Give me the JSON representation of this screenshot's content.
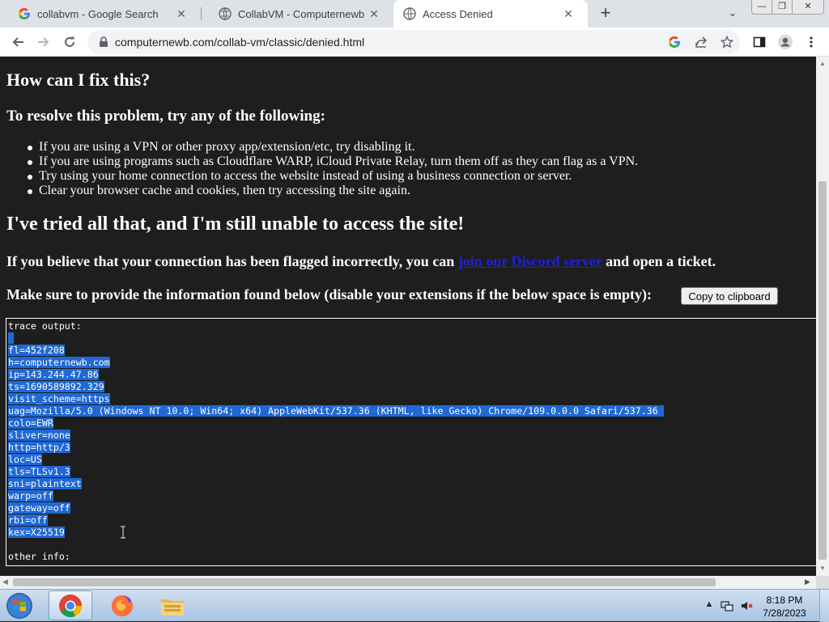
{
  "browser": {
    "tabs": [
      {
        "title": "collabvm - Google Search",
        "icon": "google-g-icon",
        "active": false
      },
      {
        "title": "CollabVM - Computernewb Wiki",
        "icon": "wiki-icon",
        "active": false
      },
      {
        "title": "Access Denied",
        "icon": "globe-icon",
        "active": true
      }
    ],
    "url": "computernewb.com/collab-vm/classic/denied.html"
  },
  "page": {
    "heading_fix": "How can I fix this?",
    "resolve_intro": "To resolve this problem, try any of the following:",
    "tips": [
      "If you are using a VPN or other proxy app/extension/etc, try disabling it.",
      "If you are using programs such as Cloudflare WARP, iCloud Private Relay, turn them off as they can flag as a VPN.",
      "Try using your home connection to access the website instead of using a business connection or server.",
      "Clear your browser cache and cookies, then try accessing the site again."
    ],
    "heading_tried": "I've tried all that, and I'm still unable to access the site!",
    "flag_text_before": "If you believe that your connection has been flagged incorrectly, you can ",
    "flag_link": "join our Discord server",
    "flag_text_after": " and open a ticket.",
    "info_text": "Make sure to provide the information found below (disable your extensions if the below space is empty):",
    "copy_button": "Copy to clipboard",
    "trace": {
      "header": "trace output:",
      "lines": [
        " ",
        "fl=452f208",
        "h=computernewb.com",
        "ip=143.244.47.86",
        "ts=1690589892.329",
        "visit_scheme=https",
        "uag=Mozilla/5.0 (Windows NT 10.0; Win64; x64) AppleWebKit/537.36 (KHTML, like Gecko) Chrome/109.0.0.0 Safari/537.36 ",
        "colo=EWR",
        "sliver=none",
        "http=http/3",
        "loc=US",
        "tls=TLSv1.3",
        "sni=plaintext",
        "warp=off",
        "gateway=off",
        "rbi=off",
        "kex=X25519"
      ],
      "other_info": "other info:"
    }
  },
  "taskbar": {
    "time": "8:18 PM",
    "date": "7/28/2023"
  },
  "colors": {
    "page_bg": "#1e1e1e",
    "selection": "#1f68d6",
    "link": "#1e1ee8"
  }
}
